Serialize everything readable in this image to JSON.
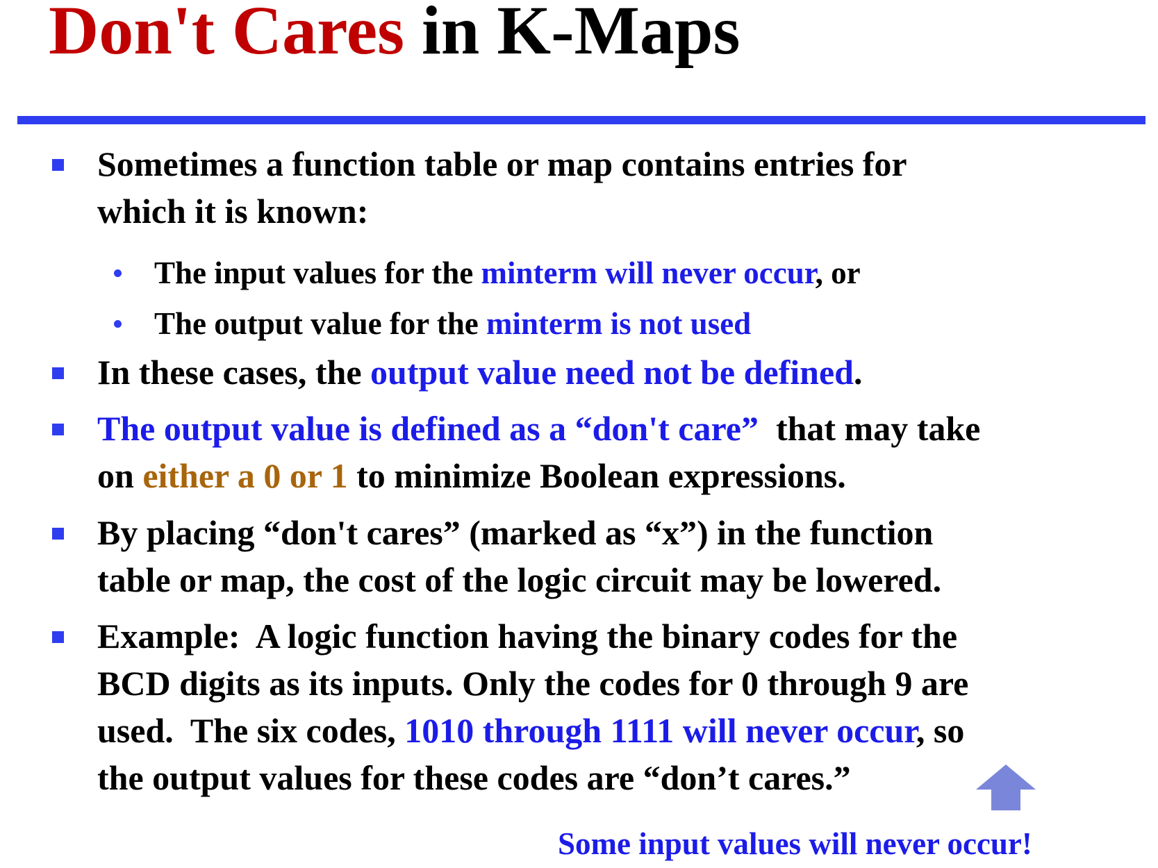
{
  "slide": {
    "title_red": "Don't Cares",
    "title_black": " in K-Maps"
  },
  "bullets": {
    "b1_line1": "Sometimes a function table or map contains entries for",
    "b1_line2": "which it is known:",
    "s1_pre": "The input values for the ",
    "s1_blue": "minterm will never occur",
    "s1_post": ", or",
    "s2_pre": "The output value for the ",
    "s2_blue": "minterm is not used",
    "b2_pre": "In these cases, the ",
    "b2_blue": "output value need not be defined",
    "b2_post": ".",
    "b3_blue": "The output value is defined as a “don't care”",
    "b3_post": "  that may take",
    "b3_l2_pre": "on ",
    "b3_l2_gold": "either a 0 or 1",
    "b3_l2_post": " to minimize Boolean expressions.",
    "b4_line1": "By placing “don't cares” (marked as “x”) in the function",
    "b4_line2": "table or map, the cost of the logic circuit may be lowered.",
    "b5_line1": "Example:  A logic function having the binary codes for the",
    "b5_line2": "BCD digits as its inputs. Only the codes for 0 through 9 are",
    "b5_l3_pre": "used.  The six codes, ",
    "b5_l3_blue": "1010 through 1111 will never occur",
    "b5_l3_post": ", so",
    "b5_line4": "the output values for these codes are “don’t cares.”"
  },
  "callout": {
    "icon": "up-arrow-icon",
    "arrow_color": "#7a86d9",
    "text": "Some input values will never occur!"
  },
  "colors": {
    "title_red": "#c00000",
    "accent_blue": "#1c1ce8",
    "rule_blue": "#2e3df0",
    "gold": "#a8650c"
  }
}
